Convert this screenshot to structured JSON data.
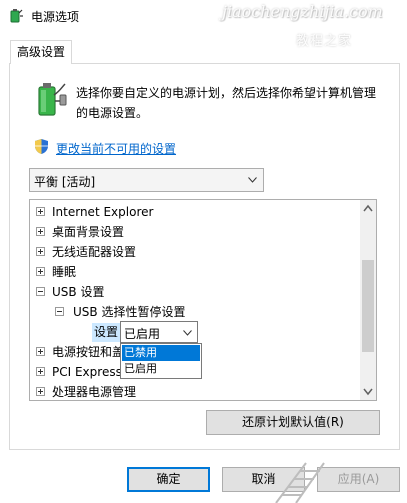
{
  "window": {
    "title": "电源选项"
  },
  "watermark": {
    "text": "jiaochengzhijia.com",
    "subtext": "教程之家"
  },
  "tab": {
    "label": "高级设置"
  },
  "description": {
    "line1": "选择你要自定义的电源计划，然后选择你希望计算机管理",
    "line2": "的电源设置。"
  },
  "change_link": {
    "label": "更改当前不可用的设置"
  },
  "plan_select": {
    "value": "平衡 [活动]"
  },
  "tree": {
    "items": [
      {
        "label": "Internet Explorer",
        "expander": "plus"
      },
      {
        "label": "桌面背景设置",
        "expander": "plus"
      },
      {
        "label": "无线适配器设置",
        "expander": "plus"
      },
      {
        "label": "睡眠",
        "expander": "plus"
      },
      {
        "label": "USB 设置",
        "expander": "minus"
      },
      {
        "label": "USB 选择性暂停设置",
        "expander": "minus"
      },
      {
        "label": "电源按钮和盖",
        "expander": "plus"
      },
      {
        "label": "PCI Express",
        "expander": "plus"
      },
      {
        "label": "处理器电源管理",
        "expander": "plus"
      }
    ],
    "setting_label": "设置",
    "setting_value": "已启用",
    "dropdown_options": [
      "已禁用",
      "已启用"
    ],
    "highlighted_option": "已禁用"
  },
  "buttons": {
    "restore": "还原计划默认值(R)",
    "ok": "确定",
    "cancel": "取消",
    "apply": "应用(A)"
  },
  "colors": {
    "accent": "#0078d7",
    "link": "#0066cc",
    "selection": "#cce8ff"
  }
}
